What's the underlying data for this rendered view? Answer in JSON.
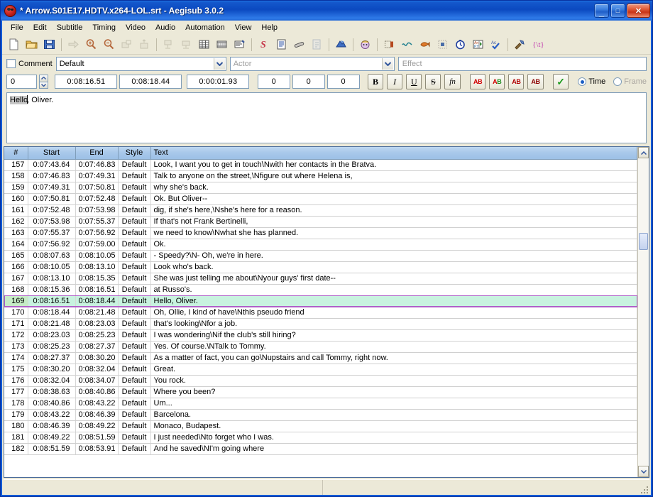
{
  "window": {
    "title": "* Arrow.S01E17.HDTV.x264-LOL.srt - Aegisub 3.0.2",
    "icon": "aegisub-icon",
    "minimize_label": "_",
    "maximize_label": "□",
    "close_label": "✕"
  },
  "menubar": {
    "items": [
      {
        "label": "File"
      },
      {
        "label": "Edit"
      },
      {
        "label": "Subtitle"
      },
      {
        "label": "Timing"
      },
      {
        "label": "Video"
      },
      {
        "label": "Audio"
      },
      {
        "label": "Automation"
      },
      {
        "label": "View"
      },
      {
        "label": "Help"
      }
    ]
  },
  "toolbar": {
    "groups": [
      [
        "new-subtitles-icon",
        "open-subtitles-icon",
        "save-subtitles-icon"
      ],
      [
        "jump-to-icon",
        "zoom-in-icon",
        "zoom-out-icon",
        "video-detach-icon",
        "video-attach-icon"
      ],
      [
        "shift-times-icon",
        "timing-postprocessor-icon",
        "styles-manager-icon",
        "attachments-icon",
        "properties-icon"
      ],
      [
        "spellchecker-icon",
        "translation-assistant-icon",
        "resample-icon",
        "export-icon"
      ],
      [
        "shift-times-dialog-icon"
      ],
      [
        "fonts-collector-icon"
      ],
      [
        "play-line-icon",
        "audio-wave-icon",
        "audio-spectrum-icon",
        "stop-icon",
        "time-icon",
        "karaoke-icon",
        "spell-check-icon"
      ],
      [
        "options-icon",
        "tags-icon"
      ]
    ]
  },
  "meta": {
    "comment_label": "Comment",
    "comment_checked": false,
    "style_value": "Default",
    "actor_placeholder": "Actor",
    "actor_value": "",
    "effect_placeholder": "Effect",
    "effect_value": ""
  },
  "timing": {
    "layer": "0",
    "start_time": "0:08:16.51",
    "end_time": "0:08:18.44",
    "duration": "0:00:01.93",
    "margin_left": "0",
    "margin_right": "0",
    "margin_vertical": "0",
    "format_buttons": [
      {
        "name": "bold-button",
        "label": "B"
      },
      {
        "name": "italic-button",
        "label": "I"
      },
      {
        "name": "underline-button",
        "label": "U"
      },
      {
        "name": "strikeout-button",
        "label": "S"
      },
      {
        "name": "font-button",
        "label": "fn"
      }
    ],
    "color_buttons": [
      {
        "name": "primary-color-button",
        "label": "AB"
      },
      {
        "name": "secondary-color-button",
        "label": "AB"
      },
      {
        "name": "outline-color-button",
        "label": "AB"
      },
      {
        "name": "shadow-color-button",
        "label": "AB"
      }
    ],
    "commit_label": "✓",
    "time_radio_label": "Time",
    "frame_radio_label": "Frame",
    "time_selected": true
  },
  "edit": {
    "selected_text": "Hello",
    "rest_text": ", Oliver."
  },
  "grid": {
    "columns": [
      {
        "key": "num",
        "label": "#"
      },
      {
        "key": "start",
        "label": "Start"
      },
      {
        "key": "end",
        "label": "End"
      },
      {
        "key": "style",
        "label": "Style"
      },
      {
        "key": "text",
        "label": "Text"
      }
    ],
    "selected_row": 169,
    "rows": [
      {
        "num": "157",
        "start": "0:07:43.64",
        "end": "0:07:46.83",
        "style": "Default",
        "text": "Look, I want you to get in touch\\Nwith her contacts in the Bratva."
      },
      {
        "num": "158",
        "start": "0:07:46.83",
        "end": "0:07:49.31",
        "style": "Default",
        "text": "Talk to anyone on the street,\\Nfigure out where Helena is,"
      },
      {
        "num": "159",
        "start": "0:07:49.31",
        "end": "0:07:50.81",
        "style": "Default",
        "text": "why she's back."
      },
      {
        "num": "160",
        "start": "0:07:50.81",
        "end": "0:07:52.48",
        "style": "Default",
        "text": "Ok. But Oliver--"
      },
      {
        "num": "161",
        "start": "0:07:52.48",
        "end": "0:07:53.98",
        "style": "Default",
        "text": "dig, if she's here,\\Nshe's here for a reason."
      },
      {
        "num": "162",
        "start": "0:07:53.98",
        "end": "0:07:55.37",
        "style": "Default",
        "text": "If that's not Frank Bertinelli,"
      },
      {
        "num": "163",
        "start": "0:07:55.37",
        "end": "0:07:56.92",
        "style": "Default",
        "text": "we need to know\\Nwhat she has planned."
      },
      {
        "num": "164",
        "start": "0:07:56.92",
        "end": "0:07:59.00",
        "style": "Default",
        "text": "Ok."
      },
      {
        "num": "165",
        "start": "0:08:07.63",
        "end": "0:08:10.05",
        "style": "Default",
        "text": "- Speedy?\\N- Oh, we're in here."
      },
      {
        "num": "166",
        "start": "0:08:10.05",
        "end": "0:08:13.10",
        "style": "Default",
        "text": "Look who's back."
      },
      {
        "num": "167",
        "start": "0:08:13.10",
        "end": "0:08:15.35",
        "style": "Default",
        "text": "She was just telling me about\\Nyour guys' first date--"
      },
      {
        "num": "168",
        "start": "0:08:15.36",
        "end": "0:08:16.51",
        "style": "Default",
        "text": "at Russo's."
      },
      {
        "num": "169",
        "start": "0:08:16.51",
        "end": "0:08:18.44",
        "style": "Default",
        "text": "Hello, Oliver."
      },
      {
        "num": "170",
        "start": "0:08:18.44",
        "end": "0:08:21.48",
        "style": "Default",
        "text": "Oh, Ollie, I kind of have\\Nthis pseudo friend"
      },
      {
        "num": "171",
        "start": "0:08:21.48",
        "end": "0:08:23.03",
        "style": "Default",
        "text": "that's looking\\Nfor a job."
      },
      {
        "num": "172",
        "start": "0:08:23.03",
        "end": "0:08:25.23",
        "style": "Default",
        "text": "I was wondering\\Nif the club's still hiring?"
      },
      {
        "num": "173",
        "start": "0:08:25.23",
        "end": "0:08:27.37",
        "style": "Default",
        "text": "Yes. Of course.\\NTalk to Tommy."
      },
      {
        "num": "174",
        "start": "0:08:27.37",
        "end": "0:08:30.20",
        "style": "Default",
        "text": "As a matter of fact, you can go\\Nupstairs and call Tommy, right now."
      },
      {
        "num": "175",
        "start": "0:08:30.20",
        "end": "0:08:32.04",
        "style": "Default",
        "text": "Great."
      },
      {
        "num": "176",
        "start": "0:08:32.04",
        "end": "0:08:34.07",
        "style": "Default",
        "text": "You rock."
      },
      {
        "num": "177",
        "start": "0:08:38.63",
        "end": "0:08:40.86",
        "style": "Default",
        "text": "Where you been?"
      },
      {
        "num": "178",
        "start": "0:08:40.86",
        "end": "0:08:43.22",
        "style": "Default",
        "text": "Um..."
      },
      {
        "num": "179",
        "start": "0:08:43.22",
        "end": "0:08:46.39",
        "style": "Default",
        "text": "Barcelona."
      },
      {
        "num": "180",
        "start": "0:08:46.39",
        "end": "0:08:49.22",
        "style": "Default",
        "text": "Monaco, Budapest."
      },
      {
        "num": "181",
        "start": "0:08:49.22",
        "end": "0:08:51.59",
        "style": "Default",
        "text": "I just needed\\Nto forget who I was."
      },
      {
        "num": "182",
        "start": "0:08:51.59",
        "end": "0:08:53.91",
        "style": "Default",
        "text": "And he saved\\NI'm going where"
      }
    ]
  },
  "statusbar": {
    "left": "",
    "right": ""
  },
  "colors": {
    "titlebar": "#0b49c0",
    "face": "#ece9d8",
    "grid_header": "#a8c8ea",
    "row_number_bg": "#cfeccf",
    "selected_row_bg": "#c8f2df",
    "selected_row_border": "#b060c8"
  }
}
